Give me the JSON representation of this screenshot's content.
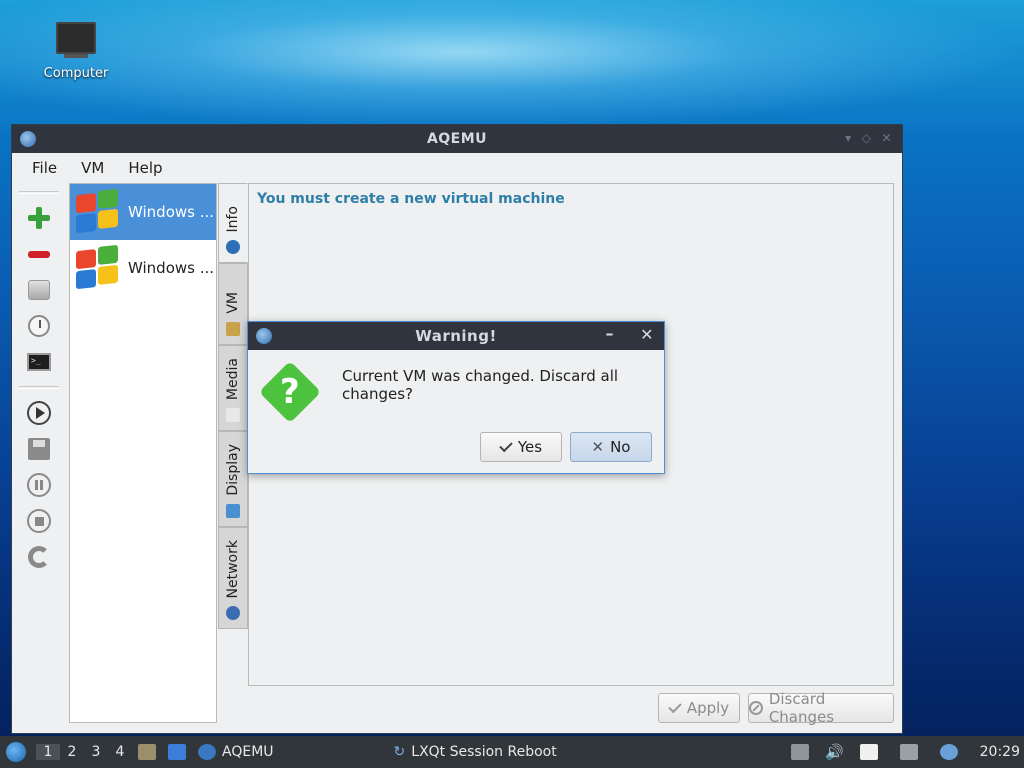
{
  "desktop": {
    "computer_label": "Computer"
  },
  "window": {
    "title": "AQEMU"
  },
  "menu": {
    "file": "File",
    "vm": "VM",
    "help": "Help"
  },
  "vm_list": [
    {
      "name": "Windows ...",
      "selected": true
    },
    {
      "name": "Windows ...",
      "selected": false
    }
  ],
  "tabs": {
    "info": "Info",
    "vm": "VM",
    "media": "Media",
    "display": "Display",
    "network": "Network"
  },
  "info": {
    "headline": "You must create a new virtual machine"
  },
  "buttons": {
    "apply": "Apply",
    "discard": "Discard Changes"
  },
  "dialog": {
    "title": "Warning!",
    "message": "Current VM was changed. Discard all changes?",
    "yes": "Yes",
    "no": "No",
    "min_glyph": "–",
    "close_glyph": "✕"
  },
  "taskbar": {
    "desktops": [
      "1",
      "2",
      "3",
      "4"
    ],
    "active_desktop": "1",
    "task_aqemu": "AQEMU",
    "task_session": "LXQt Session Reboot",
    "clock": "20:29"
  },
  "colors": {
    "accent": "#4a90d9",
    "titlebar": "#2f343f",
    "headline": "#2d7fa8"
  }
}
